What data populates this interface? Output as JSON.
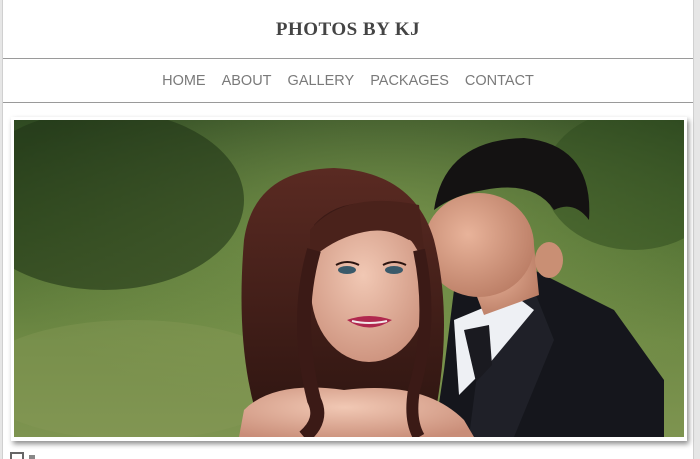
{
  "site": {
    "title": "PHOTOS BY KJ"
  },
  "nav": {
    "items": [
      {
        "label": "HOME"
      },
      {
        "label": "ABOUT"
      },
      {
        "label": "GALLERY"
      },
      {
        "label": "PACKAGES"
      },
      {
        "label": "CONTACT"
      }
    ]
  },
  "colors": {
    "title": "#444444",
    "nav_text": "#7a7a7a",
    "divider": "#9a9a9a",
    "background": "#ffffff"
  },
  "icons": {
    "below_fold": "menu-icon"
  }
}
